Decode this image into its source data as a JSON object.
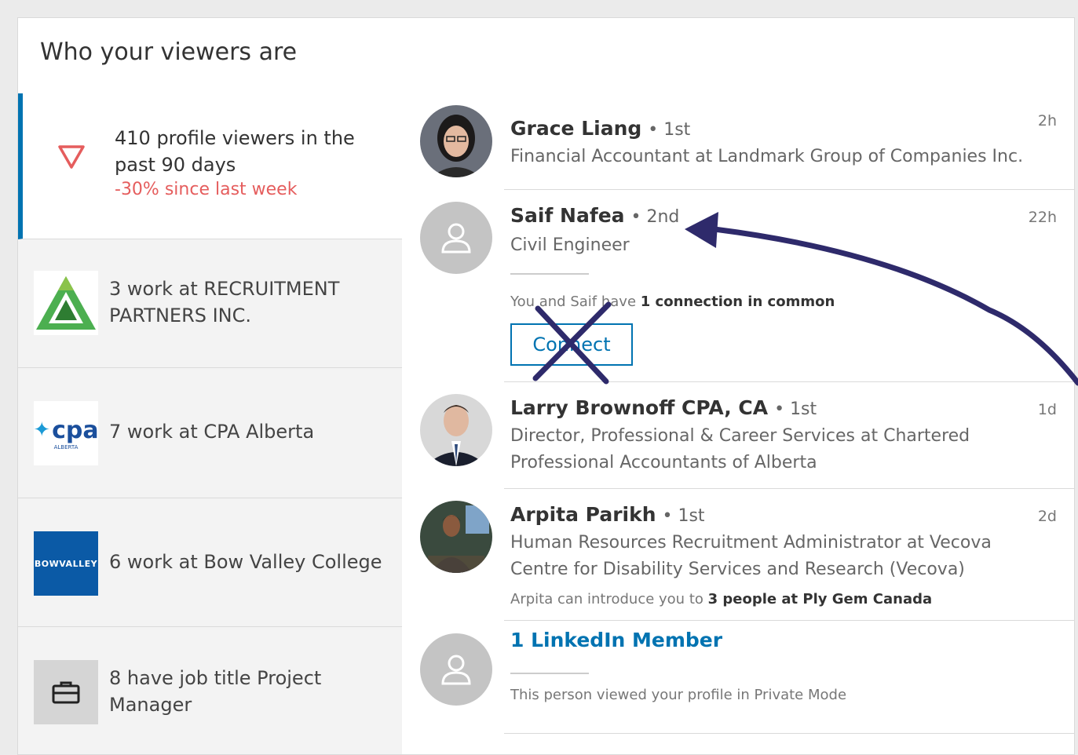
{
  "header": {
    "title": "Who your viewers are"
  },
  "stats": [
    {
      "views": "410 profile viewers in the past 90 days",
      "change": "-30% since last week",
      "icon": "trend-down-icon"
    },
    {
      "label": "3 work at RECRUITMENT PARTNERS INC.",
      "logo": "recruitment-partners-logo"
    },
    {
      "label": "7 work at CPA Alberta",
      "logo": "cpa-alberta-logo",
      "logo_text": "cpa",
      "logo_subtext": "ALBERTA"
    },
    {
      "label": "6 work at Bow Valley College",
      "logo": "bow-valley-logo",
      "logo_text": "BOWVALLEY"
    },
    {
      "label": "8 have job title Project Manager",
      "logo": "briefcase-icon"
    }
  ],
  "viewers": [
    {
      "name": "Grace Liang",
      "degree": "1st",
      "headline": "Financial Accountant at Landmark Group of Companies Inc.",
      "time": "2h"
    },
    {
      "name": "Saif Nafea",
      "degree": "2nd",
      "headline": "Civil Engineer",
      "time": "22h",
      "common_prefix": "You and Saif have ",
      "common_bold": "1 connection in common",
      "button": "Connect"
    },
    {
      "name": "Larry Brownoff CPA, CA",
      "degree": "1st",
      "headline": "Director, Professional & Career Services at Chartered Professional Accountants of Alberta",
      "time": "1d"
    },
    {
      "name": "Arpita Parikh",
      "degree": "1st",
      "headline": "Human Resources Recruitment Administrator at Vecova Centre for Disability Services and Research (Vecova)",
      "time": "2d",
      "intro_prefix": "Arpita can introduce you to ",
      "intro_bold": "3 people at Ply Gem Canada"
    },
    {
      "name": "1 LinkedIn Member",
      "note": "This person viewed your profile in Private Mode"
    }
  ],
  "colors": {
    "accent": "#0073b1",
    "negative": "#e55d5d",
    "annotation": "#2e2a6b"
  }
}
